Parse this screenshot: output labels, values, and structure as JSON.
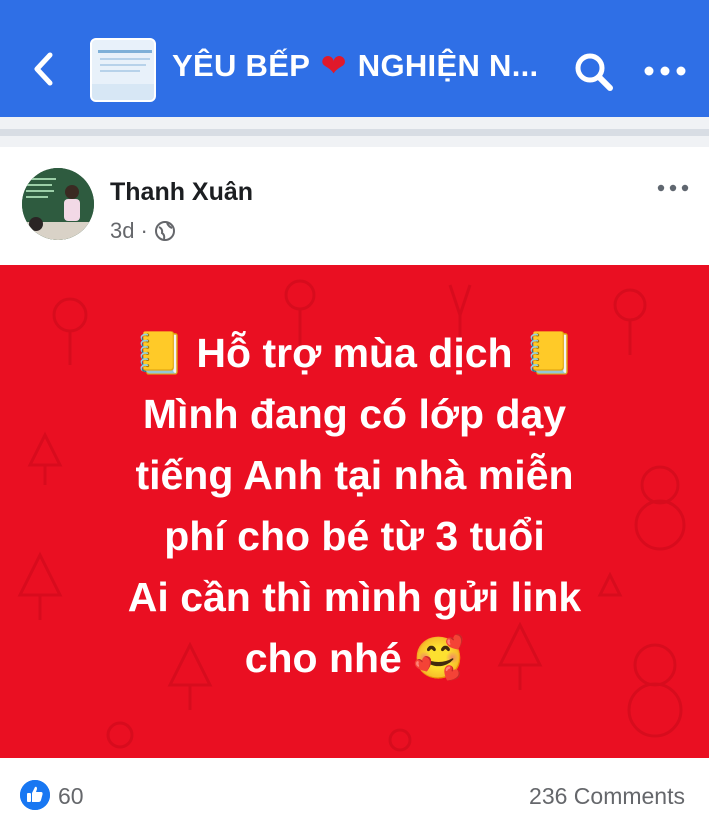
{
  "header": {
    "title_prefix": "YÊU BẾP",
    "title_suffix": "NGHIỆN N...",
    "heart": "❤",
    "back_icon": "chevron-left-icon",
    "search_icon": "search-icon",
    "more_icon": "more-horizontal-icon",
    "color": "#2f6fe6"
  },
  "post": {
    "author": "Thanh Xuân",
    "time": "3d",
    "separator": "·",
    "privacy_icon": "globe-icon",
    "background_color": "#ea0f22",
    "text_lines": [
      "📒 Hỗ trợ mùa dịch 📒",
      "Mình đang có lớp dạy",
      "tiếng Anh tại nhà miễn",
      "phí cho bé từ 3 tuổi",
      "Ai cần  thì  mình gửi link",
      "cho nhé 🥰"
    ]
  },
  "footer": {
    "like_count": "60",
    "comments": "236 Comments"
  }
}
